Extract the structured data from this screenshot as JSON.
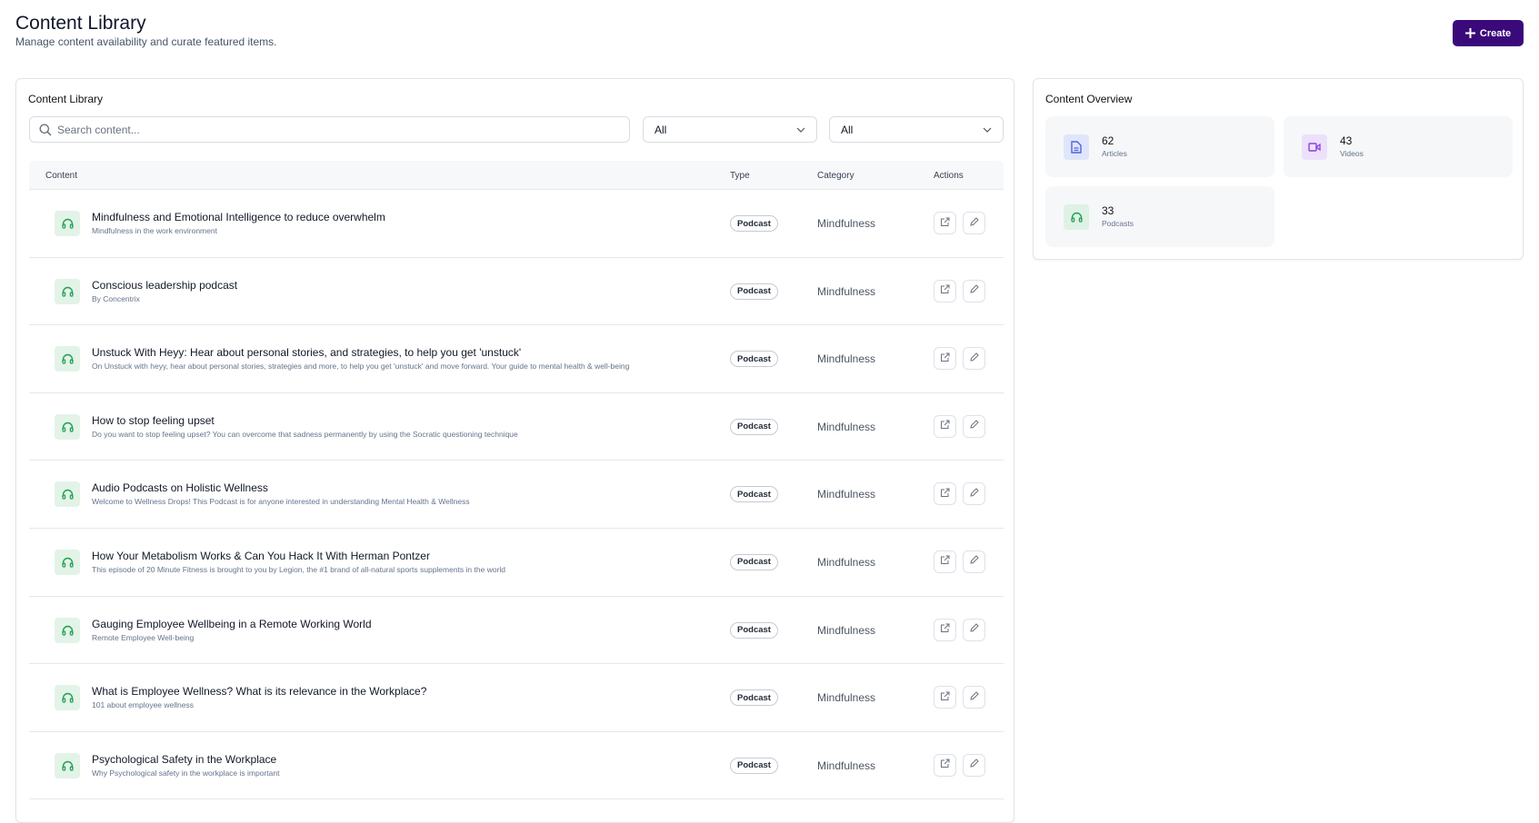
{
  "header": {
    "title": "Content Library",
    "subtitle": "Manage content availability and curate featured items.",
    "create_label": "Create"
  },
  "library": {
    "title": "Content Library",
    "search_placeholder": "Search content...",
    "filters": [
      {
        "value": "All"
      },
      {
        "value": "All"
      }
    ],
    "columns": [
      "Content",
      "Type",
      "Category",
      "Actions"
    ],
    "rows": [
      {
        "title": "Mindfulness and Emotional Intelligence to reduce overwhelm",
        "desc": "Mindfulness in the work environment",
        "type": "Podcast",
        "category": "Mindfulness"
      },
      {
        "title": "Conscious leadership podcast",
        "desc": "By Concentrix",
        "type": "Podcast",
        "category": "Mindfulness"
      },
      {
        "title": "Unstuck With Heyy: Hear about personal stories, and strategies, to help you get 'unstuck'",
        "desc": "On Unstuck with heyy, hear about personal stories, strategies and more, to help you get 'unstuck' and move forward. Your guide to mental health & well-being",
        "type": "Podcast",
        "category": "Mindfulness"
      },
      {
        "title": "How to stop feeling upset",
        "desc": "Do you want to stop feeling upset? You can overcome that sadness permanently by using the Socratic questioning technique",
        "type": "Podcast",
        "category": "Mindfulness"
      },
      {
        "title": "Audio Podcasts on Holistic Wellness",
        "desc": "Welcome to Wellness Drops! This Podcast is for anyone interested in understanding Mental Health & Wellness",
        "type": "Podcast",
        "category": "Mindfulness"
      },
      {
        "title": "How Your Metabolism Works & Can You Hack It With Herman Pontzer",
        "desc": "This episode of 20 Minute Fitness is brought to you by Legion, the #1 brand of all-natural sports supplements in the world",
        "type": "Podcast",
        "category": "Mindfulness"
      },
      {
        "title": "Gauging Employee Wellbeing in a Remote Working World",
        "desc": "Remote Employee Well-being",
        "type": "Podcast",
        "category": "Mindfulness"
      },
      {
        "title": "What is Employee Wellness? What is its relevance in the Workplace?",
        "desc": "101 about employee wellness",
        "type": "Podcast",
        "category": "Mindfulness"
      },
      {
        "title": "Psychological Safety in the Workplace",
        "desc": "Why Psychological safety in the workplace is important",
        "type": "Podcast",
        "category": "Mindfulness"
      }
    ]
  },
  "overview": {
    "title": "Content Overview",
    "stats": [
      {
        "count": "62",
        "label": "Articles",
        "icon": "document-icon",
        "color": "#4f63e6",
        "bg": "#dfe6fb"
      },
      {
        "count": "43",
        "label": "Videos",
        "icon": "video-icon",
        "color": "#8b3fe0",
        "bg": "#ece1fa"
      },
      {
        "count": "33",
        "label": "Podcasts",
        "icon": "headphones-icon",
        "color": "#22a052",
        "bg": "#dff1e5"
      }
    ]
  },
  "colors": {
    "primary": "#3b0a7a",
    "podcast": "#22a052"
  }
}
